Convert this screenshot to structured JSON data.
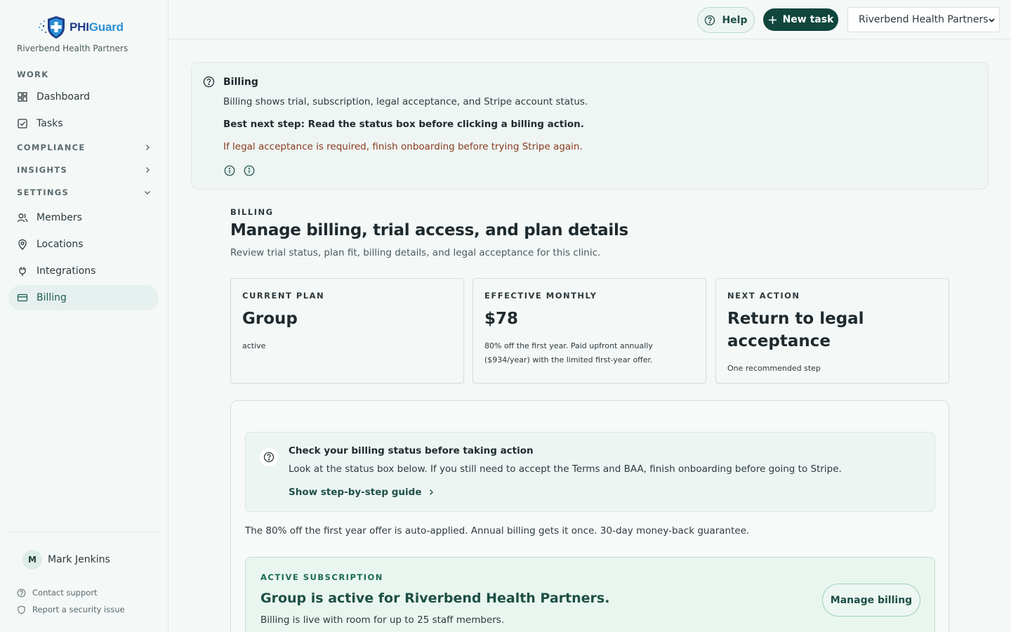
{
  "brand": {
    "logo_part1": "PHI",
    "logo_part2": "Guard",
    "org_name": "Riverbend Health Partners"
  },
  "sidebar": {
    "work_label": "WORK",
    "items_work": [
      {
        "label": "Dashboard",
        "icon": "dashboard-icon"
      },
      {
        "label": "Tasks",
        "icon": "tasks-icon"
      }
    ],
    "compliance_label": "COMPLIANCE",
    "insights_label": "INSIGHTS",
    "settings_label": "SETTINGS",
    "items_settings": [
      {
        "label": "Members",
        "icon": "members-icon"
      },
      {
        "label": "Locations",
        "icon": "location-pin-icon"
      },
      {
        "label": "Integrations",
        "icon": "plug-icon"
      },
      {
        "label": "Billing",
        "icon": "credit-card-icon",
        "active": true
      }
    ],
    "user_initial": "M",
    "user_name": "Mark Jenkins",
    "contact_support": "Contact support",
    "report_issue": "Report a security issue"
  },
  "topbar": {
    "help_label": "Help",
    "new_task_label": "New task",
    "org_select_value": "Riverbend Health Partners"
  },
  "info_banner": {
    "title": "Billing",
    "line1": "Billing shows trial, subscription, legal acceptance, and Stripe account status.",
    "line2": "Best next step: Read the status box before clicking a billing action.",
    "line3": "If legal acceptance is required, finish onboarding before trying Stripe again."
  },
  "page": {
    "eyebrow": "BILLING",
    "title": "Manage billing, trial access, and plan details",
    "subtitle": "Review trial status, plan fit, billing details, and legal acceptance for this clinic."
  },
  "cards": [
    {
      "label": "CURRENT PLAN",
      "value": "Group",
      "note": "active"
    },
    {
      "label": "EFFECTIVE MONTHLY",
      "value": "$78",
      "note": "80% off the first year. Paid upfront annually ($934/year) with the limited first-year offer."
    },
    {
      "label": "NEXT ACTION",
      "value": "Return to legal acceptance",
      "note": "One recommended step"
    }
  ],
  "guide": {
    "title": "Check your billing status before taking action",
    "text": "Look at the status box below. If you still need to accept the Terms and BAA, finish onboarding before going to Stripe.",
    "link": "Show step-by-step guide"
  },
  "offer_text": "The 80% off the first year offer is auto-applied. Annual billing gets it once. 30-day money-back guarantee.",
  "subscription": {
    "eyebrow": "ACTIVE SUBSCRIPTION",
    "title": "Group is active for Riverbend Health Partners.",
    "text": "Billing is live with room for up to 25 staff members.",
    "button": "Manage billing"
  },
  "colors": {
    "primary": "#10463c",
    "accent": "#1d4f45",
    "warning_text": "#8a3a1e",
    "success_bg": "#e9f6ef"
  }
}
